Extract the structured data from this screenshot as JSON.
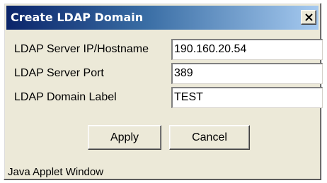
{
  "window": {
    "title": "Create LDAP Domain",
    "close_label": "×"
  },
  "form": {
    "fields": [
      {
        "label": "LDAP Server IP/Hostname",
        "value": "190.160.20.54"
      },
      {
        "label": "LDAP Server Port",
        "value": "389"
      },
      {
        "label": "LDAP Domain Label",
        "value": "TEST"
      }
    ]
  },
  "buttons": {
    "apply_label": "Apply",
    "cancel_label": "Cancel"
  },
  "status_bar": {
    "text": "Java Applet Window"
  },
  "colors": {
    "title_gradient_start": "#0a246a",
    "title_gradient_end": "#a6caf0",
    "dialog_background": "#ece9d8",
    "field_background": "#ffffff"
  },
  "icons": {
    "close": "close-icon"
  }
}
